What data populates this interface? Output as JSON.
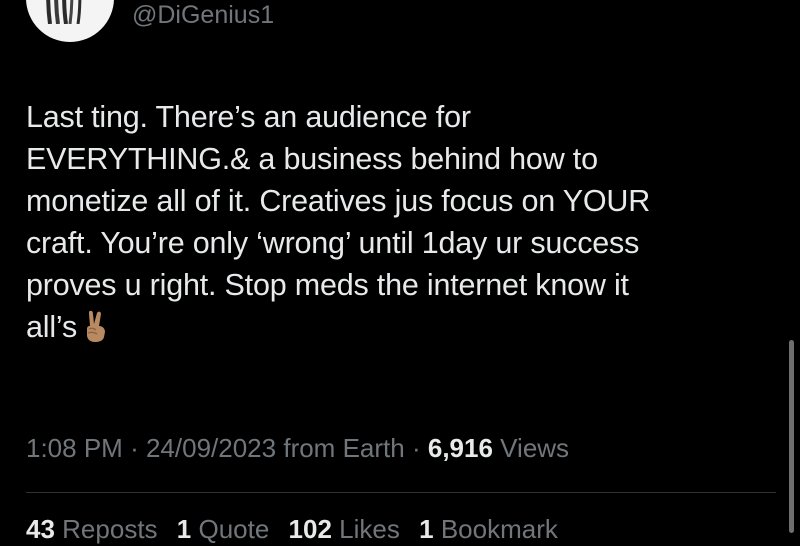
{
  "author": {
    "handle": "@DiGenius1"
  },
  "tweet": {
    "lines": [
      "Last ting. There’s an audience for",
      "EVERYTHING.& a business behind how to",
      "monetize all of it. Creatives jus focus on YOUR",
      "craft. You’re only ‘wrong’ until 1day ur success",
      "proves u right. Stop meds the internet know it",
      "all’s"
    ],
    "emoji_icon": "victory-hand-icon"
  },
  "meta": {
    "time": "1:08 PM",
    "separator": "·",
    "date": "24/09/2023",
    "location": "from Earth",
    "views_count": "6,916",
    "views_label": "Views"
  },
  "stats": {
    "reposts_count": "43",
    "reposts_label": "Reposts",
    "quotes_count": "1",
    "quotes_label": "Quote",
    "likes_count": "102",
    "likes_label": "Likes",
    "bookmarks_count": "1",
    "bookmarks_label": "Bookmark"
  },
  "colors": {
    "background": "#000000",
    "primary_text": "#e7e9ea",
    "secondary_text": "#71767b",
    "divider": "#2f3336"
  }
}
